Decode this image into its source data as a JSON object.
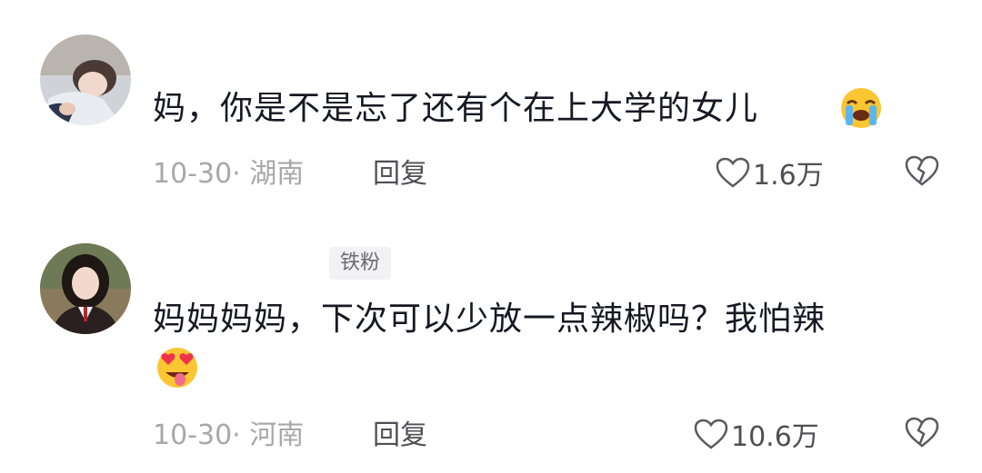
{
  "comments": [
    {
      "text": "妈，你是不是忘了还有个在上大学的女儿",
      "emoji": "loudly-crying-face-icon",
      "date_location": "10-30· 湖南",
      "reply_label": "回复",
      "likes": "1.6万"
    },
    {
      "badge": "铁粉",
      "text": "妈妈妈妈，下次可以少放一点辣椒吗？我怕辣",
      "emoji": "heart-eyes-tongue-face-icon",
      "date_location": "10-30· 河南",
      "reply_label": "回复",
      "likes": "10.6万"
    }
  ],
  "colors": {
    "text": "#161823",
    "meta": "#a8a8ab",
    "action": "#4f4f55",
    "badge_bg": "#f2f2f4"
  }
}
